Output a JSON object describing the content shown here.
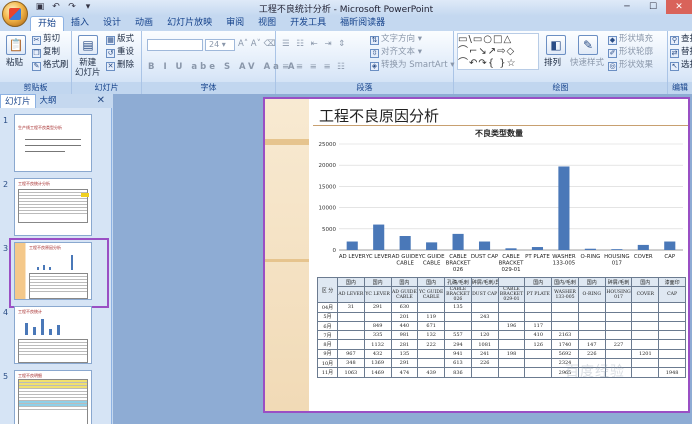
{
  "window": {
    "title": "工程不良统计分析 - Microsoft PowerPoint"
  },
  "tabs": [
    "开始",
    "插入",
    "设计",
    "动画",
    "幻灯片放映",
    "审阅",
    "视图",
    "开发工具",
    "福昕阅读器"
  ],
  "ribbon": {
    "clipboard": {
      "label": "剪贴板",
      "paste": "粘贴",
      "cut": "剪切",
      "copy": "复制",
      "format_painter": "格式刷"
    },
    "slides": {
      "label": "幻灯片",
      "new_slide": "新建\n幻灯片",
      "layout": "版式",
      "reset": "重设",
      "delete": "删除"
    },
    "font": {
      "label": "字体",
      "font_size": "24"
    },
    "paragraph": {
      "label": "段落",
      "text_direction": "文字方向",
      "align_text": "对齐文本",
      "smartart": "转换为 SmartArt"
    },
    "drawing": {
      "label": "绘图",
      "arrange": "排列",
      "quick_styles": "快速样式",
      "shape_fill": "形状填充",
      "shape_outline": "形状轮廓",
      "shape_effects": "形状效果"
    },
    "editing": {
      "label": "编辑",
      "find": "查找",
      "replace": "替换",
      "select": "选择"
    }
  },
  "panel": {
    "tab_slides": "幻灯片",
    "tab_outline": "大纲",
    "slide_numbers": [
      "1",
      "2",
      "3",
      "4",
      "5"
    ]
  },
  "slide": {
    "title": "工程不良原因分析"
  },
  "chart_data": {
    "type": "bar",
    "title": "不良类型数量",
    "categories": [
      "AD LEVER",
      "YC LEVER",
      "AD GUIDE CABLE",
      "YC GUIDE CABLE",
      "CABLE BRACKET 026",
      "DUST CAP",
      "CABLE BRACKET 029-01",
      "PT PLATE",
      "WASHER 133-005",
      "O-RING",
      "HOUSING 017",
      "COVER",
      "CAP"
    ],
    "values": [
      2000,
      6000,
      3300,
      1800,
      3800,
      2000,
      400,
      700,
      19700,
      300,
      200,
      1200,
      2000
    ],
    "ylim": [
      0,
      25000
    ],
    "yticks": [
      0,
      5000,
      10000,
      15000,
      20000,
      25000
    ],
    "color": "#4a78b8"
  },
  "table": {
    "group_header": [
      "区 分",
      "国内",
      "国内",
      "国内",
      "国内",
      "孔确/毛刺",
      "碎屑/毛刺/异物",
      "",
      "国内",
      "国内/毛刺",
      "国内",
      "碎屑/毛刺",
      "国内",
      "漆面印"
    ],
    "sub_header": [
      "AD LEVER",
      "YC LEVER",
      "AD GUIDE CABLE",
      "YC GUIDE CABLE",
      "CABLE BRACKET 026",
      "DUST CAP",
      "CABLE BRACKET 029-01",
      "PT PLATE",
      "WASHER 133-005",
      "O-RING",
      "HOUSING 017",
      "COVER",
      "CAP"
    ],
    "rows": [
      {
        "month": "04月",
        "cells": [
          "31",
          "291",
          "630",
          "",
          "135",
          "",
          "",
          "",
          "",
          "",
          "",
          "",
          ""
        ]
      },
      {
        "month": "5月",
        "cells": [
          "",
          "",
          "201",
          "119",
          "",
          "243",
          "",
          "",
          "",
          "",
          "",
          "",
          ""
        ]
      },
      {
        "month": "6月",
        "cells": [
          "",
          "849",
          "440",
          "671",
          "",
          "",
          "196",
          "117",
          "",
          "",
          "",
          "",
          ""
        ]
      },
      {
        "month": "7月",
        "cells": [
          "",
          "335",
          "981",
          "132",
          "557",
          "120",
          "",
          "410",
          "2163",
          "",
          "",
          "",
          ""
        ]
      },
      {
        "month": "8月",
        "cells": [
          "",
          "1132",
          "281",
          "222",
          "294",
          "1081",
          "",
          "126",
          "1740",
          "147",
          "227",
          "",
          ""
        ]
      },
      {
        "month": "9月",
        "cells": [
          "967",
          "432",
          "135",
          "",
          "941",
          "241",
          "198",
          "",
          "5692",
          "226",
          "",
          "1201",
          ""
        ]
      },
      {
        "month": "10月",
        "cells": [
          "348",
          "1369",
          "291",
          "",
          "613",
          "226",
          "",
          "",
          "2324",
          "",
          "",
          "",
          ""
        ]
      },
      {
        "month": "11月",
        "cells": [
          "1063",
          "1469",
          "474",
          "439",
          "836",
          "",
          "",
          "",
          "2965",
          "",
          "",
          "",
          "1948"
        ]
      }
    ]
  }
}
